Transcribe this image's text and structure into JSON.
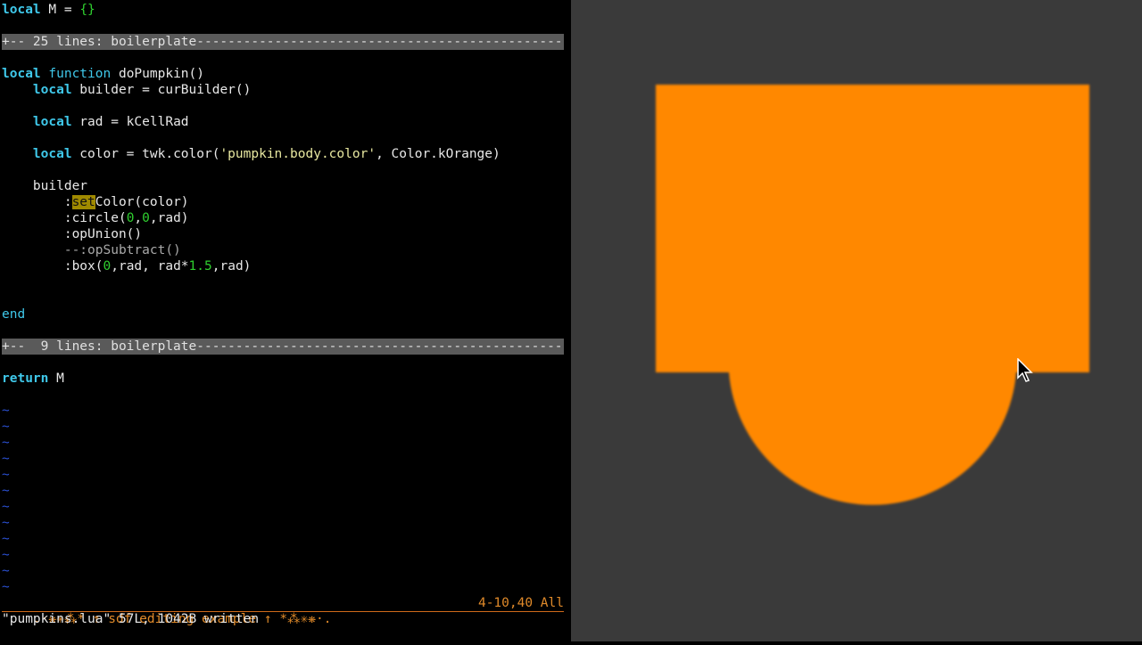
{
  "editor": {
    "lines": {
      "l1": {
        "kw": "local",
        "rest": " M = ",
        "braces": "{}"
      },
      "fold1": "+-- 25 lines: boilerplate--------------------------------------------------",
      "l4": {
        "kw": "local",
        "kw2": "function",
        "rest": " doPumpkin()"
      },
      "l5": {
        "indent": "    ",
        "kw": "local",
        "rest": " builder = curBuilder()"
      },
      "l7": {
        "indent": "    ",
        "kw": "local",
        "rest": " rad = kCellRad"
      },
      "l9": {
        "indent": "    ",
        "kw": "local",
        "rest1": " color = twk.color(",
        "str": "'pumpkin.body.color'",
        "rest2": ", Color.kOrange)"
      },
      "l11": {
        "text": "    builder"
      },
      "l12": {
        "indent": "        :",
        "hl": "set",
        "rest": "Color(color)"
      },
      "l13": {
        "a": "        :circle(",
        "n1": "0",
        ",": ",",
        "n2": "0",
        "b": ",rad)"
      },
      "l14": {
        "text": "        :opUnion()"
      },
      "l15": {
        "text": "        --:opSubtract()"
      },
      "l16": {
        "a": "        :box(",
        "n1": "0",
        "b": ",rad, rad*",
        "n2": "1.5",
        "c": ",rad)"
      },
      "l19": {
        "kw": "end"
      },
      "fold2": "+--  9 lines: boilerplate--------------------------------------------------",
      "l23": {
        "kw": "return",
        "rest": " M"
      }
    },
    "tilde": "~",
    "status_left": ".·❋✳⁂* ↑ sdf editing example ↑ *⁂✳❋·.",
    "status_right": "4-10,40 All",
    "message": "\"pumpkins.lua\" 57L, 1042B written"
  },
  "viewport": {
    "shape_color": "#ff8800",
    "background": "#3a3a3a"
  }
}
